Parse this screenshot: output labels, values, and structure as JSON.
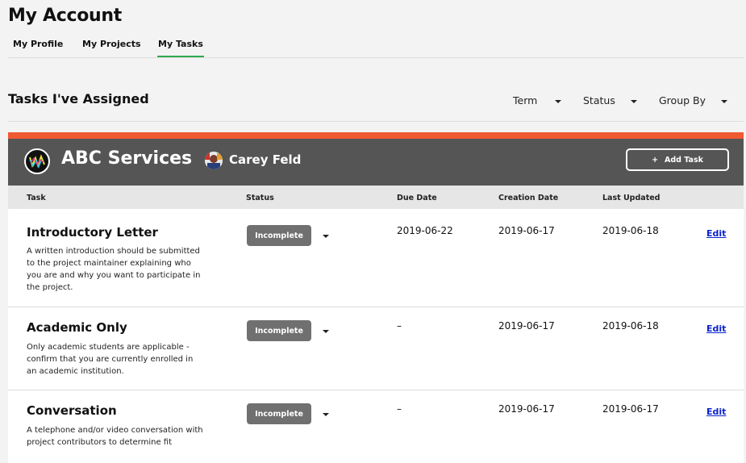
{
  "page": {
    "title": "My Account"
  },
  "tabs": [
    {
      "label": "My Profile",
      "active": false
    },
    {
      "label": "My Projects",
      "active": false
    },
    {
      "label": "My Tasks",
      "active": true
    }
  ],
  "section": {
    "title": "Tasks I've Assigned",
    "filters": [
      {
        "label": "Term"
      },
      {
        "label": "Status"
      },
      {
        "label": "Group By"
      }
    ]
  },
  "card": {
    "accent_color": "#f05a32",
    "org_name": "ABC Services",
    "person_name": "Carey Feld",
    "add_task_label": "Add Task",
    "add_task_icon": "+",
    "columns": [
      "Task",
      "Status",
      "Due Date",
      "Creation Date",
      "Last Updated"
    ]
  },
  "tasks": [
    {
      "name": "Introductory Letter",
      "description_lines": [
        "A written introduction should be submitted",
        "to the project maintainer explaining who",
        "you are and why you want to participate in",
        "the project."
      ],
      "status": "Incomplete",
      "due_date": "2019-06-22",
      "creation_date": "2019-06-17",
      "last_updated": "2019-06-18",
      "edit_label": "Edit"
    },
    {
      "name": "Academic Only",
      "description_lines": [
        "Only academic students are applicable -",
        "confirm that you are currently enrolled in",
        "an academic institution."
      ],
      "status": "Incomplete",
      "due_date": "–",
      "creation_date": "2019-06-17",
      "last_updated": "2019-06-18",
      "edit_label": "Edit"
    },
    {
      "name": "Conversation",
      "description_lines": [
        "A telephone and/or video conversation with",
        "project contributors to determine fit"
      ],
      "status": "Incomplete",
      "due_date": "–",
      "creation_date": "2019-06-17",
      "last_updated": "2019-06-17",
      "edit_label": "Edit"
    }
  ]
}
